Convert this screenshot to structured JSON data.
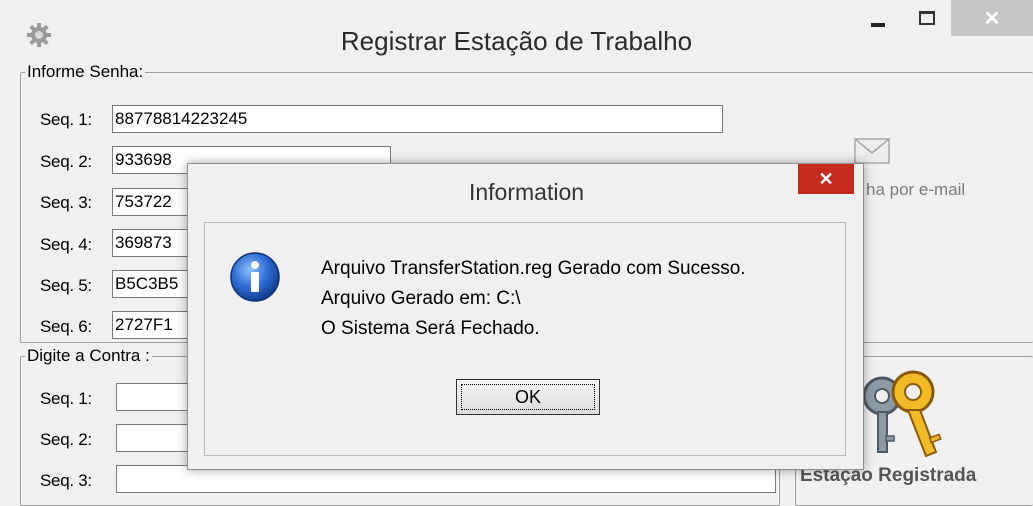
{
  "window": {
    "title": "Registrar Estação de Trabalho",
    "close_glyph": "✕"
  },
  "senha_group": {
    "legend": "Informe Senha:",
    "rows": [
      {
        "label": "Seq. 1:",
        "value": "88778814223245"
      },
      {
        "label": "Seq. 2:",
        "value": "933698"
      },
      {
        "label": "Seq. 3:",
        "value": "753722"
      },
      {
        "label": "Seq. 4:",
        "value": "369873"
      },
      {
        "label": "Seq. 5:",
        "value": "B5C3B5"
      },
      {
        "label": "Seq. 6:",
        "value": "2727F1"
      }
    ],
    "email_text": "ha por e-mail",
    "email_icon": "envelope-icon"
  },
  "contra_group": {
    "legend": "Digite a Contra :",
    "rows": [
      {
        "label": "Seq. 1:",
        "value": ""
      },
      {
        "label": "Seq. 2:",
        "value": ""
      },
      {
        "label": "Seq. 3:",
        "value": ""
      }
    ]
  },
  "status": {
    "label": "Estação Registrada",
    "icon": "keys-icon"
  },
  "dialog": {
    "title": "Information",
    "close_glyph": "✕",
    "icon": "info-icon",
    "lines": [
      "Arquivo TransferStation.reg Gerado com Sucesso.",
      "Arquivo Gerado em: C:\\",
      "O Sistema Será Fechado."
    ],
    "ok_label": "OK"
  },
  "colors": {
    "background": "#f0f0f0",
    "dialog_close": "#c42b1c",
    "window_close": "#c7c7c7",
    "info_blue": "#1f5fc0"
  }
}
